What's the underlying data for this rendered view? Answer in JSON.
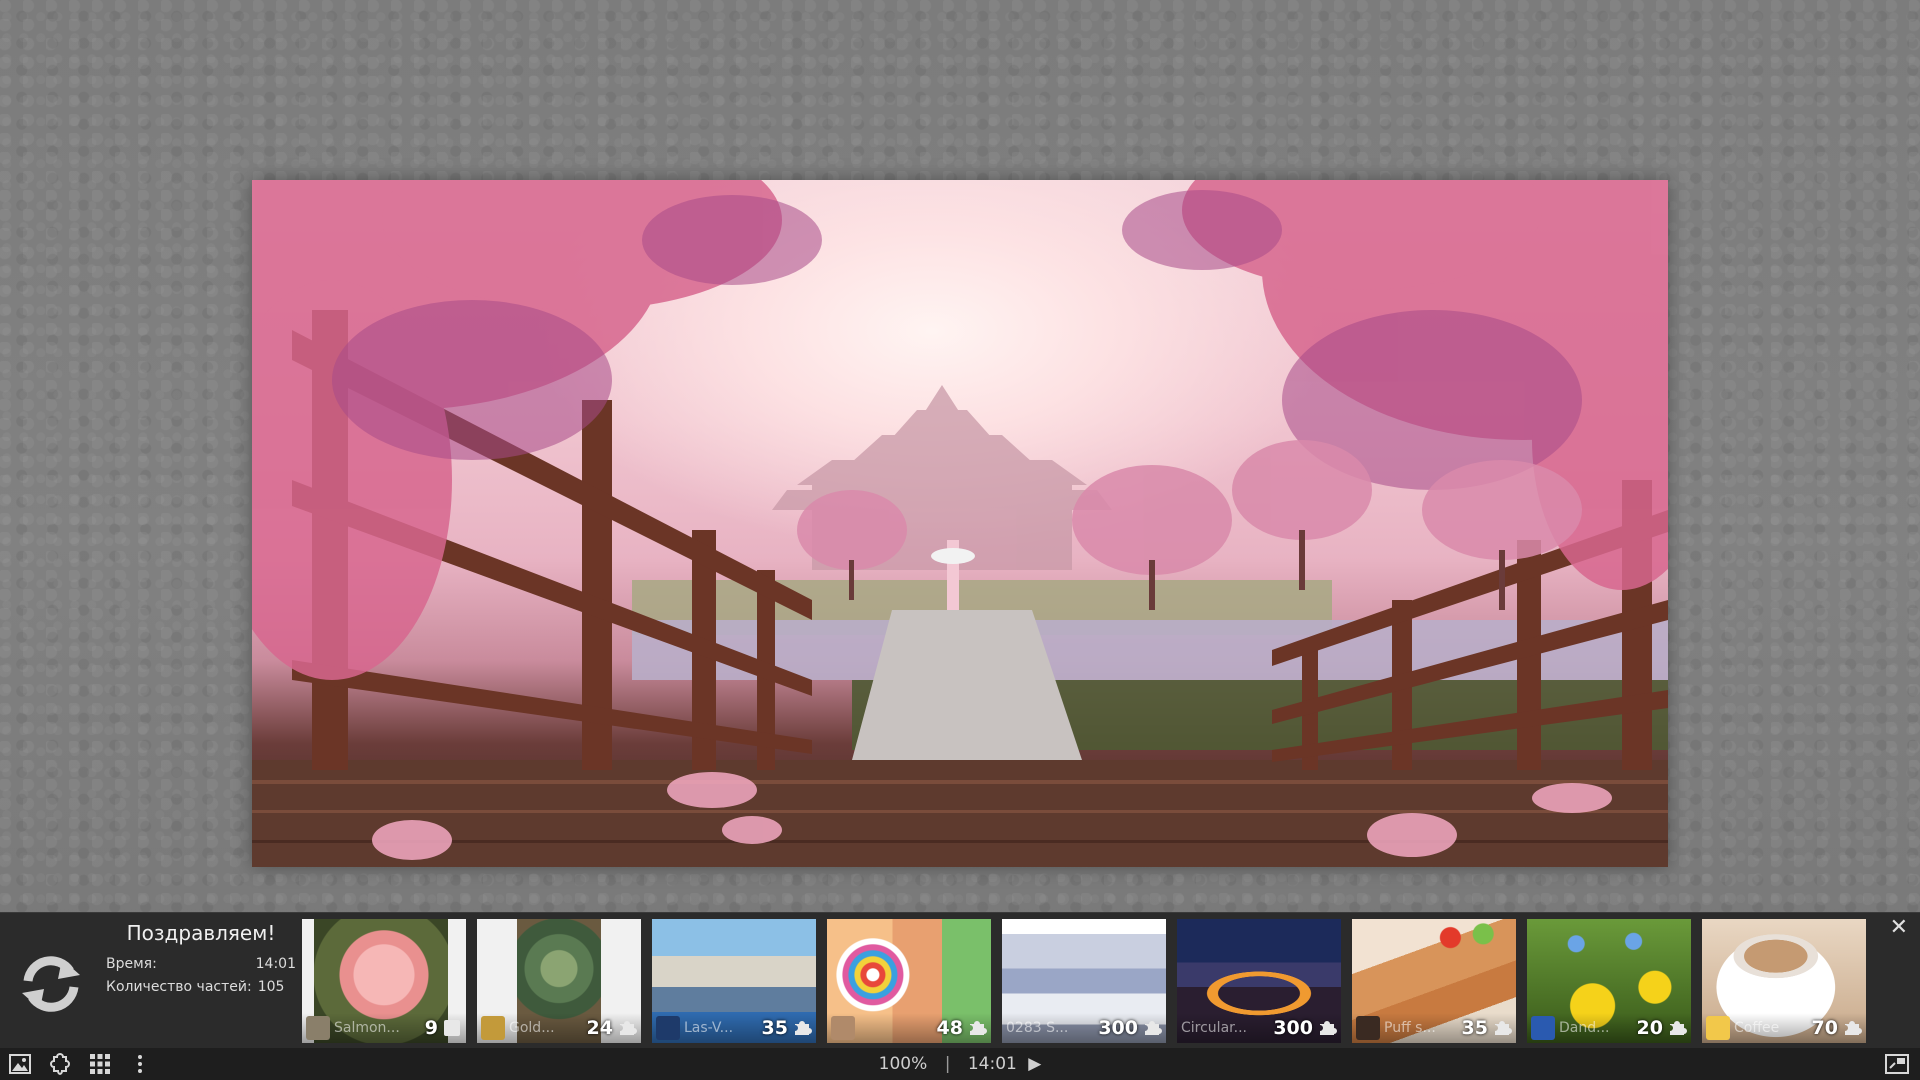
{
  "panel": {
    "congrats_title": "Поздравляем!",
    "time_label": "Время:",
    "time_value": "14:01",
    "pieces_label": "Количество частей:",
    "pieces_value": "105",
    "close_glyph": "✕"
  },
  "thumbnails": [
    {
      "name": "Salmon...",
      "count": "9",
      "accent": "#e99aa0"
    },
    {
      "name": "Gold...",
      "count": "24",
      "accent": "#6b8a5a"
    },
    {
      "name": "Las-V...",
      "count": "35",
      "accent": "#4c8fc7"
    },
    {
      "name": "",
      "count": "48",
      "accent": "#f0a030"
    },
    {
      "name": "0283 S...",
      "count": "300",
      "accent": "#c5cde0"
    },
    {
      "name": "Circular...",
      "count": "300",
      "accent": "#e07a20"
    },
    {
      "name": "Puff s...",
      "count": "35",
      "accent": "#c88a5a"
    },
    {
      "name": "Dand...",
      "count": "20",
      "accent": "#f2d020"
    },
    {
      "name": "Coffee",
      "count": "70",
      "accent": "#b07850"
    }
  ],
  "statusbar": {
    "zoom": "100%",
    "separator": "|",
    "time": "14:01",
    "play_glyph": "▶"
  },
  "icons": {
    "refresh": "refresh-icon",
    "image": "image-icon",
    "puzzle_piece": "puzzle-piece-icon",
    "grid": "grid-icon",
    "more": "more-vertical-icon",
    "fullscreen": "fullscreen-icon"
  },
  "colors": {
    "panel_bg": "#2b2b2b",
    "statusbar_bg": "#1e1e1e",
    "desk_bg": "#7d7d7d"
  }
}
